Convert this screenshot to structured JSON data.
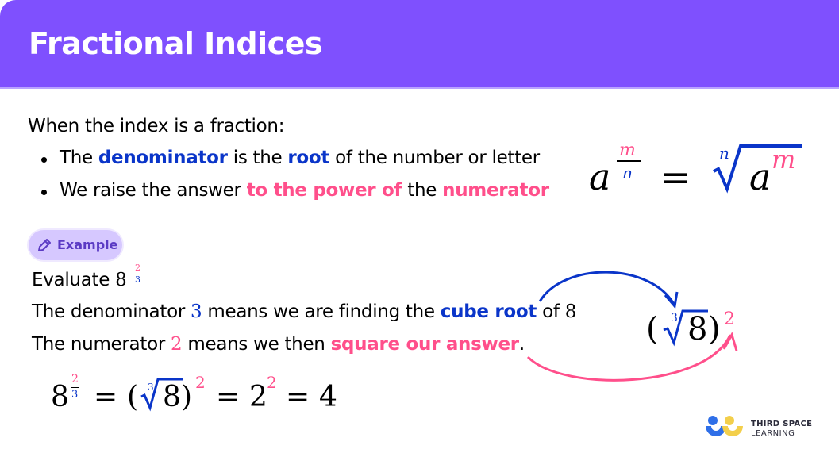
{
  "header": {
    "title": "Fractional Indices"
  },
  "intro": {
    "lead": "When the index is a fraction:",
    "bullets": [
      {
        "parts": [
          "The ",
          "denominator",
          " is the ",
          "root",
          " of the number or letter"
        ]
      },
      {
        "parts": [
          "We raise the answer ",
          "to the power of",
          " the ",
          "numerator"
        ]
      }
    ]
  },
  "formula": {
    "base": "a",
    "numerator": "m",
    "denominator": "n",
    "equals": "=",
    "root_index": "n",
    "radicand": "a",
    "power": "m"
  },
  "example": {
    "badge_label": "Example",
    "evaluate_label": "Evaluate ",
    "evaluate_base": "8",
    "evaluate_num": "2",
    "evaluate_den": "3",
    "line1": [
      "The denominator ",
      "3",
      " means we are finding the ",
      "cube root",
      " of ",
      "8"
    ],
    "line2": [
      "The numerator ",
      "2",
      " means we then ",
      "square our answer",
      "."
    ]
  },
  "diagram": {
    "open": "(",
    "root_index": "3",
    "radicand": "8",
    "close": ")",
    "power": "2"
  },
  "working": {
    "base": "8",
    "num": "2",
    "den": "3",
    "eq1": "=",
    "open": "(",
    "root_index": "3",
    "radicand": "8",
    "close": ")",
    "power1": "2",
    "eq2": "=",
    "base2": "2",
    "power2": "2",
    "eq3": "=",
    "result": "4"
  },
  "logo": {
    "line1": "THIRD SPACE",
    "line2": "LEARNING"
  },
  "colors": {
    "header": "#7f50fe",
    "blue": "#0a35c9",
    "pink": "#ff4f8b",
    "badge": "#d6c8ff"
  }
}
